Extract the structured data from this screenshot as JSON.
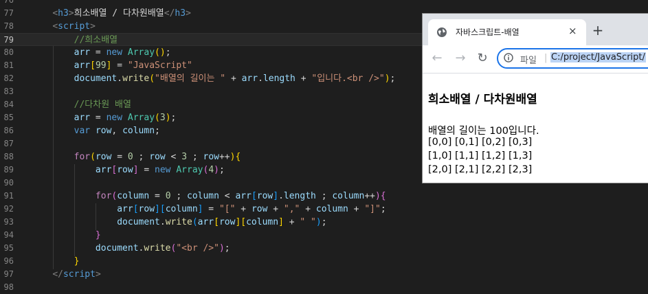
{
  "editor": {
    "lines": [
      {
        "n": "76"
      },
      {
        "n": "77"
      },
      {
        "n": "78"
      },
      {
        "n": "79"
      },
      {
        "n": "80"
      },
      {
        "n": "81"
      },
      {
        "n": "82"
      },
      {
        "n": "83"
      },
      {
        "n": "84"
      },
      {
        "n": "85"
      },
      {
        "n": "86"
      },
      {
        "n": "87"
      },
      {
        "n": "88"
      },
      {
        "n": "89"
      },
      {
        "n": "90"
      },
      {
        "n": "91"
      },
      {
        "n": "92"
      },
      {
        "n": "93"
      },
      {
        "n": "94"
      },
      {
        "n": "95"
      },
      {
        "n": "96"
      },
      {
        "n": "97"
      },
      {
        "n": "98"
      }
    ],
    "code": {
      "l77_tag": "h3",
      "l77_text": "희소배열 / 다차원배열",
      "l78_tag": "script",
      "l79": "//희소배열",
      "l82_str1": "\"배열의 길이는 \"",
      "l82_str2": "\"입니다.<br />\"",
      "l84": "//다차원 배열",
      "l93_s1": "\"[\"",
      "l93_s2": "\",\"",
      "l93_s3": "\"]\"",
      "l94_s": "\" \"",
      "l96_s": "\"<br />\"",
      "l98_tag": "script"
    }
  },
  "browser": {
    "tab_title": "자바스크립트-배열",
    "tab_close": "×",
    "new_tab": "+",
    "back": "←",
    "forward": "→",
    "reload": "↻",
    "scheme": "파일",
    "url_sep": "|",
    "url": "C:/project/JavaScript/",
    "heading": "희소배열 / 다차원배열",
    "output": [
      "배열의 길이는 100입니다.",
      "[0,0] [0,1] [0,2] [0,3]",
      "[1,0] [1,1] [1,2] [1,3]",
      "[2,0] [2,1] [2,2] [2,3]"
    ]
  },
  "colors": {
    "editor_bg": "#1e1e1e",
    "accent": "#1a73e8",
    "selection": "#bcd4f5"
  },
  "icons": [
    "globe-icon",
    "close-icon",
    "plus-icon",
    "back-arrow-icon",
    "forward-arrow-icon",
    "reload-icon",
    "info-icon"
  ]
}
